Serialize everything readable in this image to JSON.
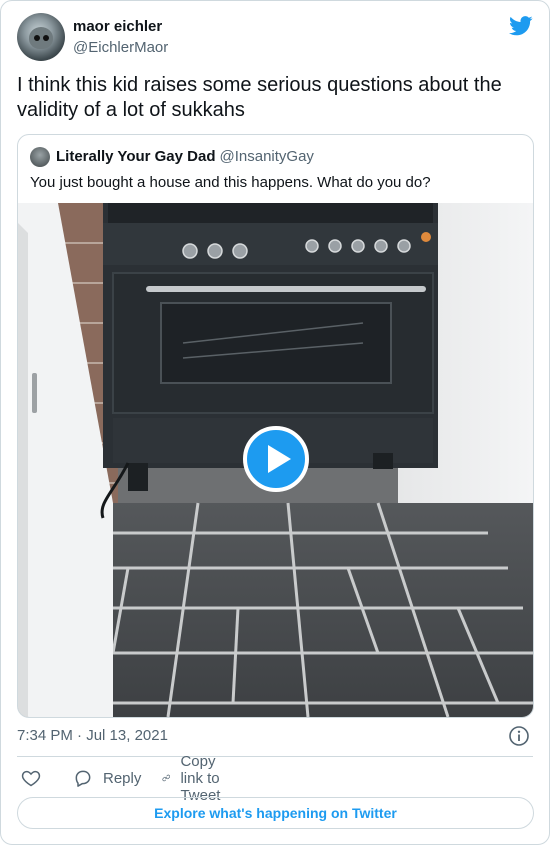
{
  "tweet": {
    "author_name": "maor eichler",
    "author_handle": "@EichlerMaor",
    "text": "I think this kid raises some serious questions about the validity of a lot of sukkahs",
    "time": "7:34 PM",
    "separator": "·",
    "date": "Jul 13, 2021"
  },
  "quoted": {
    "author_name": "Literally Your Gay Dad",
    "author_handle": "@InsanityGay",
    "text": "You just bought a house and this happens. What do you do?"
  },
  "actions": {
    "reply_label": "Reply",
    "copy_link_label": "Copy link to Tweet"
  },
  "footer": {
    "explore_label": "Explore what's happening on Twitter"
  },
  "colors": {
    "accent": "#1d9bf0",
    "secondary_text": "#536471",
    "border": "#cfd9de"
  },
  "icons": [
    "twitter-bird-icon",
    "play-icon",
    "info-icon",
    "heart-icon",
    "reply-icon",
    "link-icon"
  ]
}
